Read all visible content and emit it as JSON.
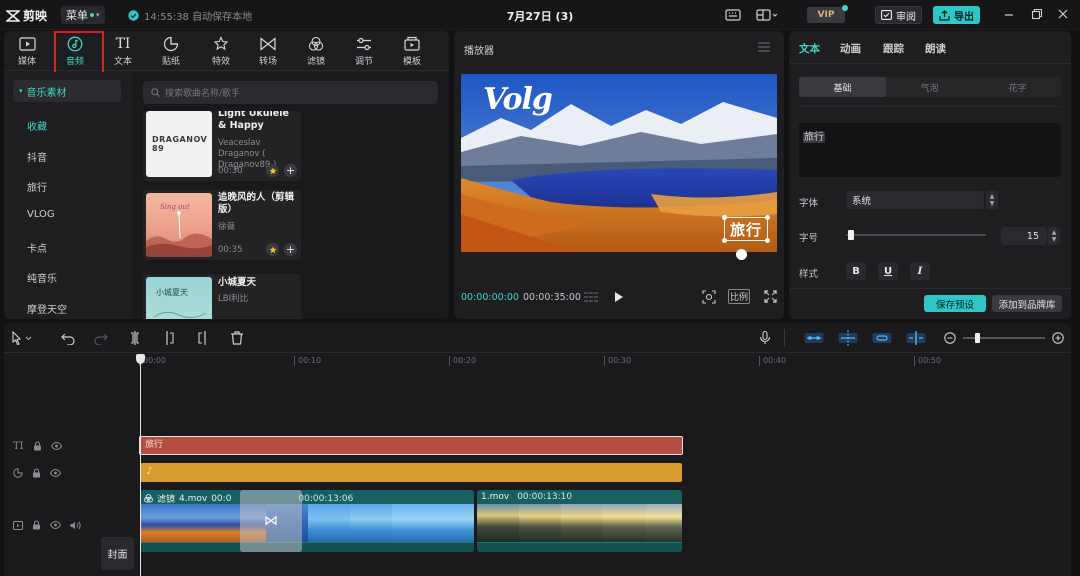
{
  "app": {
    "name": "剪映",
    "menu_label": "菜单",
    "save_status": "14:55:38 自动保存本地",
    "doc_title": "7月27日 (3)",
    "vip_label": "VIP",
    "review_label": "审阅",
    "export_label": "导出",
    "accent": "#3fd6c6"
  },
  "tool_tabs": [
    {
      "label": "媒体",
      "icon": "media-icon"
    },
    {
      "label": "音频",
      "icon": "audio-icon",
      "active": true
    },
    {
      "label": "文本",
      "icon": "text-icon"
    },
    {
      "label": "贴纸",
      "icon": "sticker-icon"
    },
    {
      "label": "特效",
      "icon": "effects-icon"
    },
    {
      "label": "转场",
      "icon": "transition-icon"
    },
    {
      "label": "滤镜",
      "icon": "filter-icon"
    },
    {
      "label": "调节",
      "icon": "adjust-icon"
    },
    {
      "label": "模板",
      "icon": "template-icon"
    }
  ],
  "sidebar": {
    "category": "音乐素材",
    "items": [
      "收藏",
      "抖音",
      "旅行",
      "VLOG",
      "卡点",
      "纯音乐",
      "摩登天空"
    ]
  },
  "library": {
    "search_placeholder": "搜索歌曲名称/歌手",
    "cards": [
      {
        "title": "Light Ukulele & Happy",
        "artist": "Veaceslav Draganov ( Draganov89 )",
        "duration": "00:30",
        "cover_text": "DRAGANOV 89"
      },
      {
        "title": "追晚风的人（剪辑版）",
        "artist": "徐薇",
        "duration": "00:35",
        "cover_text": ""
      },
      {
        "title": "小城夏天",
        "artist": "LBI利比",
        "duration": "",
        "cover_text": ""
      }
    ]
  },
  "player": {
    "title": "播放器",
    "overlay_script": "Volg",
    "overlay_text": "旅行",
    "time_current": "00:00:00:00",
    "time_total": "00:00:35:00",
    "ratio_label": "比例"
  },
  "properties": {
    "tabs": [
      "文本",
      "动画",
      "跟踪",
      "朗读"
    ],
    "sub_tabs": [
      "基础",
      "气泡",
      "花字"
    ],
    "text_value": "旅行",
    "font_label": "字体",
    "font_value": "系统",
    "size_label": "字号",
    "size_value": "15",
    "style_label": "样式",
    "style_buttons": [
      "B",
      "U",
      "I"
    ],
    "save_preset_label": "保存预设",
    "add_brand_label": "添加到品牌库"
  },
  "timeline": {
    "ticks": [
      "00:00",
      "00:10",
      "00:20",
      "00:30",
      "00:40",
      "00:50"
    ],
    "text_clip_label": "旅行",
    "audio_clip_label": "♪",
    "cover_label": "封面",
    "clips": [
      {
        "filter": "滤镜",
        "name": "4.mov",
        "timecode": "00:00:13:06"
      },
      {
        "filter": "",
        "name": "1.mov",
        "timecode": "00:00:13:10"
      }
    ],
    "clip_a_hidden_tc": "00:0"
  }
}
